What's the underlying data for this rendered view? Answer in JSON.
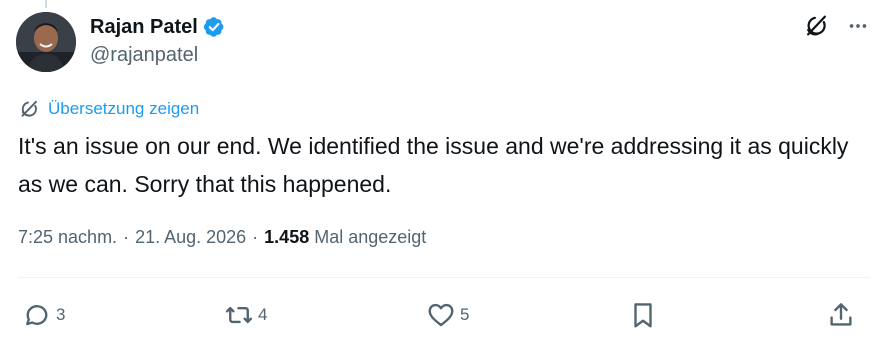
{
  "author": {
    "display_name": "Rajan Patel",
    "handle": "@rajanpatel",
    "verified": true,
    "verified_color": "#1d9bf0"
  },
  "header_actions": {
    "grok_icon": "grok-icon",
    "more_icon": "more-icon"
  },
  "translate": {
    "label": "Übersetzung zeigen",
    "icon": "translate-icon",
    "color": "#1d9bf0"
  },
  "tweet": {
    "text": "It's an issue on our end. We identified the issue and we're addressing it as quickly as we can. Sorry that this happened."
  },
  "meta": {
    "time": "7:25 nachm.",
    "separator": "·",
    "date": "21. Aug. 2026",
    "views_count": "1.458",
    "views_label": "Mal angezeigt"
  },
  "actions": {
    "reply": {
      "icon": "reply-icon",
      "count": "3"
    },
    "repost": {
      "icon": "repost-icon",
      "count": "4"
    },
    "like": {
      "icon": "like-icon",
      "count": "5"
    },
    "bookmark": {
      "icon": "bookmark-icon"
    },
    "share": {
      "icon": "share-icon"
    }
  }
}
